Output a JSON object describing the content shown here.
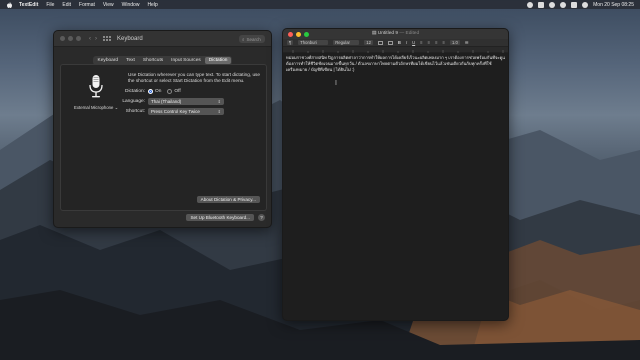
{
  "menubar": {
    "apple_icon": "apple-icon",
    "app_name": "TextEdit",
    "items": [
      "File",
      "Edit",
      "Format",
      "View",
      "Window",
      "Help"
    ],
    "clock": "Mon 20 Sep 08:25"
  },
  "keyboard_window": {
    "title": "Keyboard",
    "search_placeholder": "Search",
    "tabs": [
      "Keyboard",
      "Text",
      "Shortcuts",
      "Input Sources",
      "Dictation"
    ],
    "active_tab": "Dictation",
    "mic_label": "External Microphone ⌄",
    "description": "Use Dictation wherever you can type text. To start dictating, use the shortcut or select Start Dictation from the Edit menu.",
    "dictation_label": "Dictation:",
    "dictation_on": "On",
    "dictation_off": "Off",
    "language_label": "Language:",
    "language_value": "Thai (Thailand)",
    "shortcut_label": "Shortcut:",
    "shortcut_value": "Press Control Key Twice",
    "about_button": "About Dictation & Privacy...",
    "bluetooth_button": "Set Up Bluetooth Keyboard...",
    "help_button": "?"
  },
  "textedit_window": {
    "title": "Untitled 9",
    "edited": "— Edited",
    "toolbar": {
      "paragraph_style": "¶",
      "font": "Thonburi",
      "style": "Regular",
      "size": "12",
      "spacing": "1.0"
    },
    "body_lines": [
      "หม่อมราชวงศ์สายสนิท ปิฎการผลิตศาลาว่าการทำให้ผลการได้เคลียร์เร็วนะผลิตเพลงมาก ๆ เราต้องการช่วยพร้อมกันที่จะดูแลตัวเองในตอนนี้แล้วครับ",
      "ต้องการทำให้ชีวิตชัดเจนมากขึ้นทุกวัน / ตัวเลขภาษาไทยตามตัวอักษรที่ผมได้เขียนไว้แล้วเช่นเดียวกันกับทุกครั้งที่ใช้",
      "เครื่องหมาย / บัญชีที่เขียน | ได้ยินไม่ :)"
    ]
  }
}
